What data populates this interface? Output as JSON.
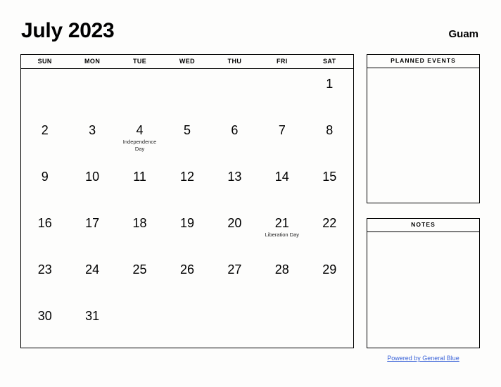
{
  "header": {
    "month_title": "July 2023",
    "location": "Guam"
  },
  "calendar": {
    "weekdays": [
      "SUN",
      "MON",
      "TUE",
      "WED",
      "THU",
      "FRI",
      "SAT"
    ],
    "weeks": [
      [
        {
          "num": "",
          "event": ""
        },
        {
          "num": "",
          "event": ""
        },
        {
          "num": "",
          "event": ""
        },
        {
          "num": "",
          "event": ""
        },
        {
          "num": "",
          "event": ""
        },
        {
          "num": "",
          "event": ""
        },
        {
          "num": "1",
          "event": ""
        }
      ],
      [
        {
          "num": "2",
          "event": ""
        },
        {
          "num": "3",
          "event": ""
        },
        {
          "num": "4",
          "event": "Independence Day"
        },
        {
          "num": "5",
          "event": ""
        },
        {
          "num": "6",
          "event": ""
        },
        {
          "num": "7",
          "event": ""
        },
        {
          "num": "8",
          "event": ""
        }
      ],
      [
        {
          "num": "9",
          "event": ""
        },
        {
          "num": "10",
          "event": ""
        },
        {
          "num": "11",
          "event": ""
        },
        {
          "num": "12",
          "event": ""
        },
        {
          "num": "13",
          "event": ""
        },
        {
          "num": "14",
          "event": ""
        },
        {
          "num": "15",
          "event": ""
        }
      ],
      [
        {
          "num": "16",
          "event": ""
        },
        {
          "num": "17",
          "event": ""
        },
        {
          "num": "18",
          "event": ""
        },
        {
          "num": "19",
          "event": ""
        },
        {
          "num": "20",
          "event": ""
        },
        {
          "num": "21",
          "event": "Liberation Day"
        },
        {
          "num": "22",
          "event": ""
        }
      ],
      [
        {
          "num": "23",
          "event": ""
        },
        {
          "num": "24",
          "event": ""
        },
        {
          "num": "25",
          "event": ""
        },
        {
          "num": "26",
          "event": ""
        },
        {
          "num": "27",
          "event": ""
        },
        {
          "num": "28",
          "event": ""
        },
        {
          "num": "29",
          "event": ""
        }
      ],
      [
        {
          "num": "30",
          "event": ""
        },
        {
          "num": "31",
          "event": ""
        },
        {
          "num": "",
          "event": ""
        },
        {
          "num": "",
          "event": ""
        },
        {
          "num": "",
          "event": ""
        },
        {
          "num": "",
          "event": ""
        },
        {
          "num": "",
          "event": ""
        }
      ]
    ]
  },
  "planned_events": {
    "title": "PLANNED EVENTS",
    "content": ""
  },
  "notes": {
    "title": "NOTES",
    "content": ""
  },
  "footer": {
    "link_text": "Powered by General Blue",
    "link_color": "#3a63d8"
  }
}
